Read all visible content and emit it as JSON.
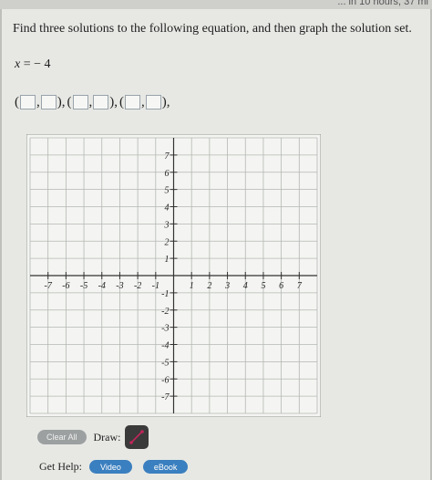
{
  "header": {
    "status_text": "... in 10 hours, 37 mi"
  },
  "question": {
    "prompt": "Find three solutions to the following equation, and then graph the solution set.",
    "equation_lhs": "x",
    "equation_rhs": "=  − 4"
  },
  "answers": {
    "pairs": [
      {
        "open": "(",
        "sep": ",",
        "close": "),",
        "x_value": "",
        "y_value": ""
      },
      {
        "open": "(",
        "sep": ",",
        "close": "),",
        "x_value": "",
        "y_value": ""
      },
      {
        "open": "(",
        "sep": ",",
        "close": "),",
        "x_value": "",
        "y_value": ""
      }
    ]
  },
  "chart_data": {
    "type": "scatter",
    "xlim": [
      -7,
      7
    ],
    "ylim": [
      -7,
      7
    ],
    "grid": true,
    "x_tick_labels": [
      "-7",
      "-6",
      "-5",
      "-4",
      "-3",
      "-2",
      "-1",
      "1",
      "2",
      "3",
      "4",
      "5",
      "6",
      "7"
    ],
    "y_tick_labels": [
      "7",
      "6",
      "5",
      "4",
      "3",
      "2",
      "1",
      "-1",
      "-2",
      "-3",
      "-4",
      "-5",
      "-6",
      "-7"
    ],
    "x_tick_values": [
      -7,
      -6,
      -5,
      -4,
      -3,
      -2,
      -1,
      1,
      2,
      3,
      4,
      5,
      6,
      7
    ],
    "y_tick_values": [
      7,
      6,
      5,
      4,
      3,
      2,
      1,
      -1,
      -2,
      -3,
      -4,
      -5,
      -6,
      -7
    ],
    "points": []
  },
  "controls": {
    "clear_all_label": "Clear All",
    "draw_label": "Draw:",
    "draw_tool_icon": "line-tool-icon"
  },
  "help": {
    "label": "Get Help:",
    "video_label": "Video",
    "ebook_label": "eBook"
  },
  "colors": {
    "grid": "#b4b7b3",
    "axis": "#333333",
    "help_button": "#3a7fbf"
  }
}
